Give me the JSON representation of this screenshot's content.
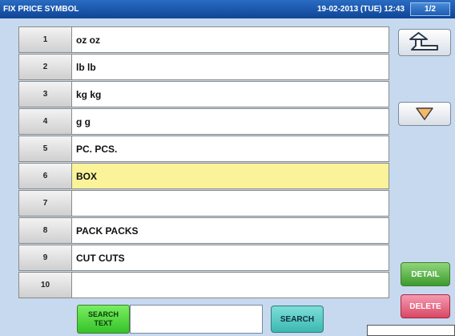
{
  "header": {
    "title": "FIX PRICE SYMBOL",
    "datetime": "19-02-2013 (TUE) 12:43",
    "page": "1/2"
  },
  "list": {
    "selected_index": 6,
    "rows": [
      {
        "num": "1",
        "name": "oz oz"
      },
      {
        "num": "2",
        "name": "lb lb"
      },
      {
        "num": "3",
        "name": "kg kg"
      },
      {
        "num": "4",
        "name": "g g"
      },
      {
        "num": "5",
        "name": "PC. PCS."
      },
      {
        "num": "6",
        "name": "BOX"
      },
      {
        "num": "7",
        "name": ""
      },
      {
        "num": "8",
        "name": "PACK PACKS"
      },
      {
        "num": "9",
        "name": "CUT CUTS"
      },
      {
        "num": "10",
        "name": ""
      }
    ]
  },
  "nav": {
    "back_icon": "return-arrow-icon",
    "down_icon": "triangle-down-icon"
  },
  "actions": {
    "detail_label": "DETAIL",
    "delete_label": "DELETE"
  },
  "search": {
    "label_line1": "SEARCH",
    "label_line2": "TEXT",
    "value": "",
    "button_label": "SEARCH"
  },
  "colors": {
    "title_bar": "#1a56b0",
    "background": "#c7d9ee",
    "selected_row": "#fbf39a",
    "detail_green": "#3d9a2d",
    "delete_pink": "#d94865",
    "search_cyan": "#3bb8b0"
  }
}
